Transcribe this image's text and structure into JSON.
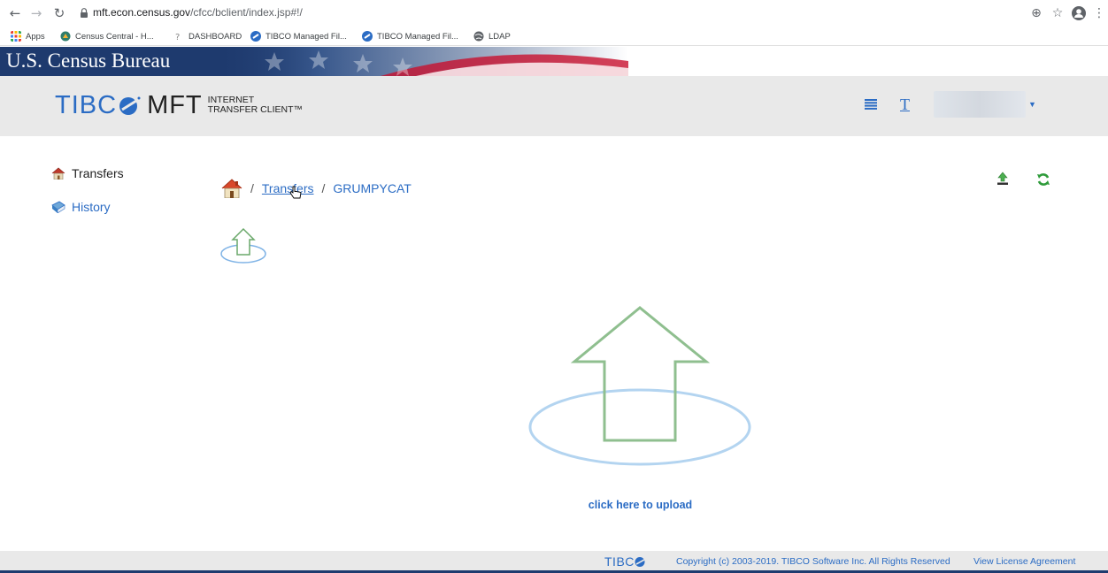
{
  "browser": {
    "url_host": "mft.econ.census.gov",
    "url_path": "/cfcc/bclient/index.jsp#!/",
    "bookmarks": [
      {
        "label": "Apps",
        "icon": "apps-grid-icon"
      },
      {
        "label": "Census Central - H...",
        "icon": "census-icon"
      },
      {
        "label": "DASHBOARD",
        "icon": "dashboard-icon"
      },
      {
        "label": "TIBCO Managed Fil...",
        "icon": "tibco-icon"
      },
      {
        "label": "TIBCO Managed Fil...",
        "icon": "tibco-icon"
      },
      {
        "label": "LDAP",
        "icon": "globe-icon"
      }
    ]
  },
  "banner": {
    "title": "U.S. Census Bureau"
  },
  "header": {
    "logo_tibco": "TIBC",
    "logo_mft": "MFT",
    "logo_sub_line1": "INTERNET",
    "logo_sub_line2": "TRANSFER CLIENT™",
    "text_icon_glyph": "T"
  },
  "sidebar": {
    "items": [
      {
        "label": "Transfers",
        "icon": "home-icon"
      },
      {
        "label": "History",
        "icon": "book-icon"
      }
    ]
  },
  "breadcrumb": {
    "separator": "/",
    "parent": "Transfers",
    "current": "GRUMPYCAT"
  },
  "main": {
    "upload_link": "click here to upload"
  },
  "footer": {
    "logo": "TIBC",
    "copyright": "Copyright (c) 2003-2019. TIBCO Software Inc. All Rights Reserved",
    "license": "View License Agreement"
  },
  "colors": {
    "accent": "#2b6cc4",
    "banner": "#1e3a6e",
    "upload_arrow": "#8fbf8f",
    "upload_ellipse": "#b3d4f0"
  }
}
